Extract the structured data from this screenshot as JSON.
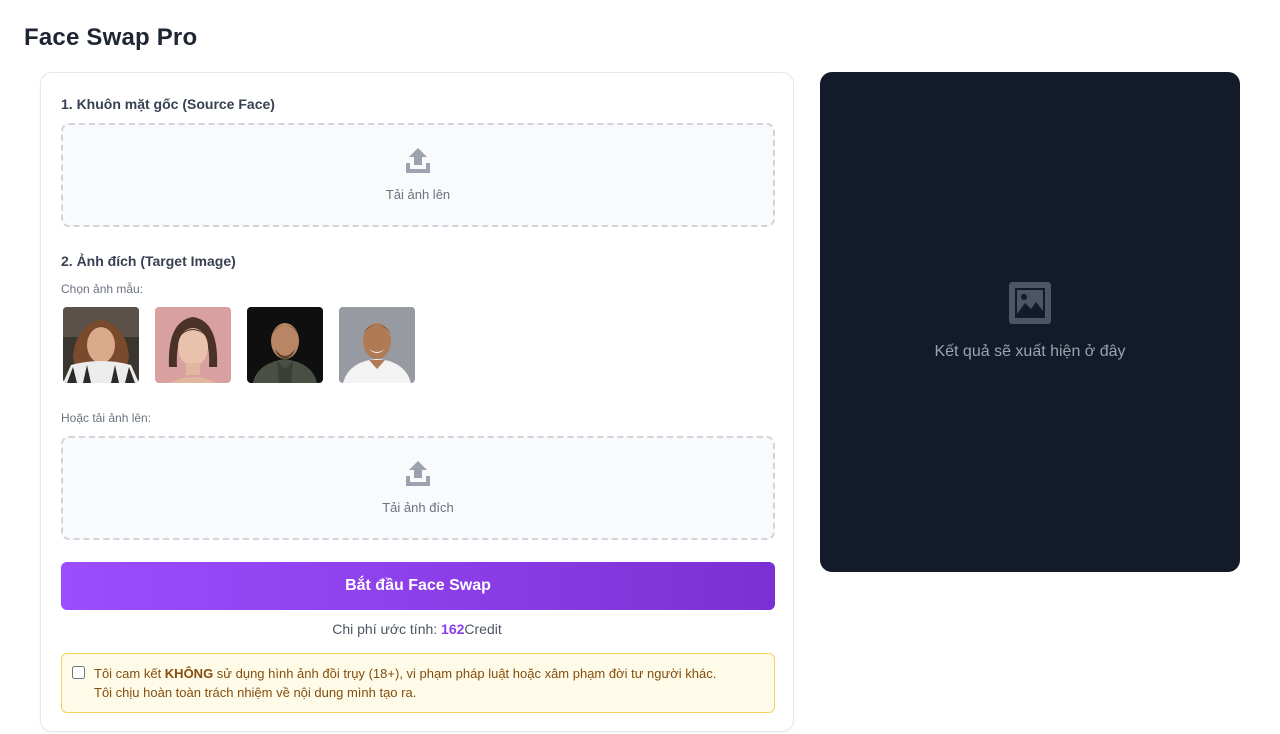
{
  "header": {
    "title": "Face Swap Pro"
  },
  "source": {
    "label": "1. Khuôn mặt gốc (Source Face)",
    "upload_text": "Tải ảnh lên"
  },
  "target": {
    "label": "2. Ảnh đích (Target Image)",
    "samples_label": "Chọn ảnh mẫu:",
    "upload_label": "Hoặc tải ảnh lên:",
    "upload_text": "Tải ảnh đích"
  },
  "action": {
    "start_label": "Bắt đầu Face Swap",
    "cost_prefix": "Chi phí ước tính: ",
    "cost_value": "162",
    "cost_unit": "Credit"
  },
  "consent": {
    "text_before": "Tôi cam kết ",
    "text_bold": "KHÔNG",
    "text_after": " sử dụng hình ảnh đồi trụy (18+), vi phạm pháp luật hoặc xâm phạm đời tư người khác.",
    "text_line2": "Tôi chịu hoàn toàn trách nhiệm về nội dung mình tạo ra.",
    "checked": false
  },
  "result": {
    "placeholder": "Kết quả sẽ xuất hiện ở đây"
  },
  "colors": {
    "accent": "#8b3ee8",
    "result_bg": "#131a29",
    "consent_bg": "#fefce8",
    "consent_border": "#f4d260"
  }
}
